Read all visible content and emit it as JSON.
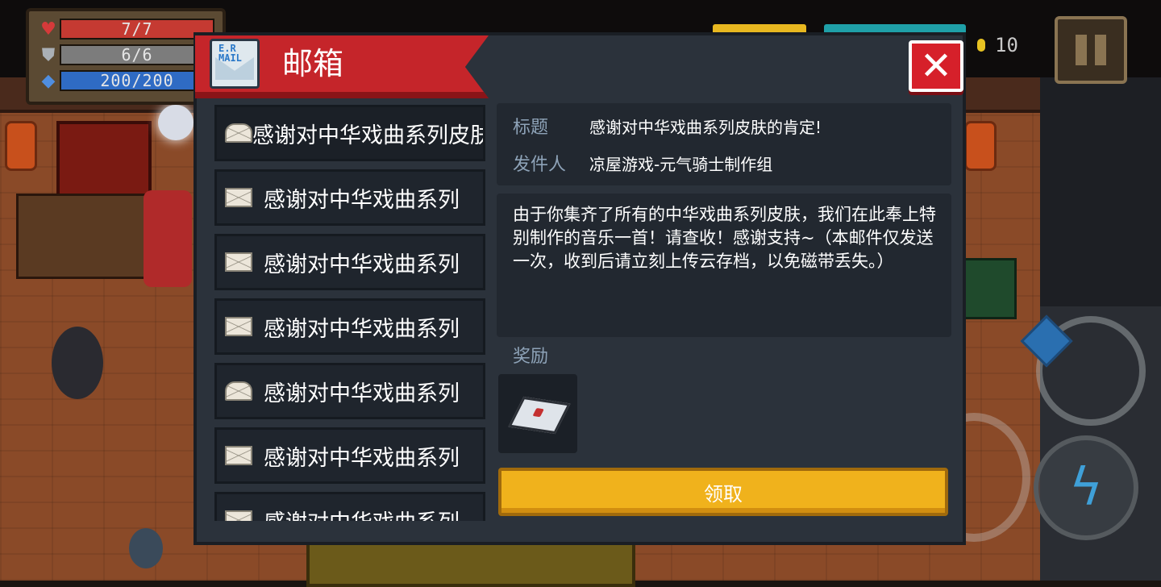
{
  "hud": {
    "hp": "7/7",
    "armor": "6/6",
    "energy": "200/200",
    "coins": "10"
  },
  "mailbox": {
    "title": "邮箱",
    "logo_text": "E.R MAIL",
    "mails": [
      {
        "label": "感谢对中华戏曲系列皮肤的肯定!",
        "state": "open"
      },
      {
        "label": "感谢对中华戏曲系列",
        "state": "closed"
      },
      {
        "label": "感谢对中华戏曲系列",
        "state": "closed"
      },
      {
        "label": "感谢对中华戏曲系列",
        "state": "closed"
      },
      {
        "label": "感谢对中华戏曲系列",
        "state": "open"
      },
      {
        "label": "感谢对中华戏曲系列",
        "state": "closed"
      },
      {
        "label": "感谢对中华戏曲系列",
        "state": "closed"
      }
    ],
    "detail": {
      "subject_label": "标题",
      "subject": "感谢对中华戏曲系列皮肤的肯定!",
      "sender_label": "发件人",
      "sender": "凉屋游戏-元气骑士制作组",
      "body": "由于你集齐了所有的中华戏曲系列皮肤，我们在此奉上特别制作的音乐一首！请查收！感谢支持~（本邮件仅发送一次，收到后请立刻上传云存档，以免磁带丢失。）",
      "reward_label": "奖励",
      "reward_icon": "cassette-tape-icon",
      "claim_label": "领取"
    }
  },
  "colors": {
    "header_red": "#c5252a",
    "panel_bg": "#2b323b",
    "claim_yellow": "#f0b21c",
    "label_blue_gray": "#8ea3b8"
  }
}
